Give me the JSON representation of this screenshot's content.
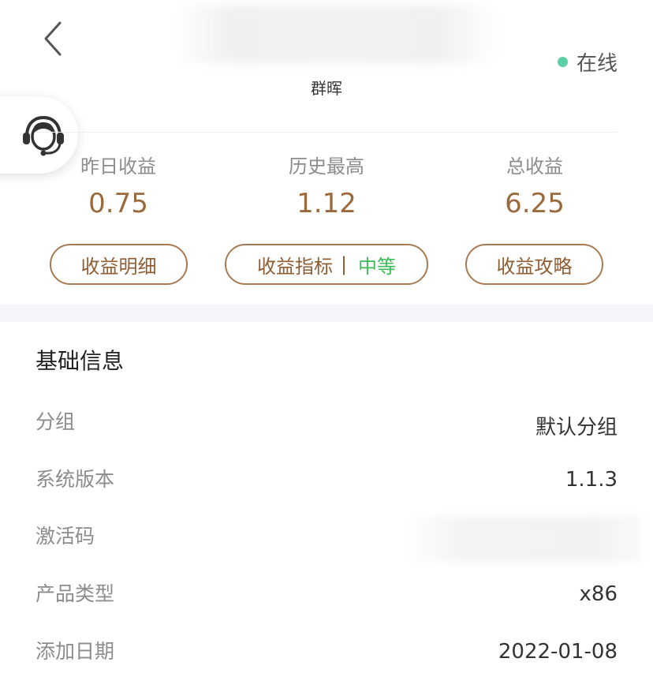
{
  "header": {
    "device_name": "群晖",
    "status": {
      "label": "在线",
      "color": "#5ed0a6"
    },
    "back_icon": "chevron-left-icon",
    "support_icon": "customer-service-headset-icon"
  },
  "stats": [
    {
      "label": "昨日收益",
      "value": "0.75"
    },
    {
      "label": "历史最高",
      "value": "1.12"
    },
    {
      "label": "总收益",
      "value": "6.25"
    }
  ],
  "actions": {
    "detail_label": "收益明细",
    "indicator_label": "收益指标",
    "indicator_sep": "|",
    "indicator_level": "中等",
    "guide_label": "收益攻略"
  },
  "colors": {
    "accent": "#9a6a3c",
    "pill_border": "#a87a52",
    "level": "#3dbb5a"
  },
  "info": {
    "title": "基础信息",
    "rows": [
      {
        "label": "分组",
        "value": "默认分组"
      },
      {
        "label": "系统版本",
        "value": "1.1.3"
      },
      {
        "label": "激活码",
        "value": ""
      },
      {
        "label": "产品类型",
        "value": "x86"
      },
      {
        "label": "添加日期",
        "value": "2022-01-08"
      }
    ]
  }
}
